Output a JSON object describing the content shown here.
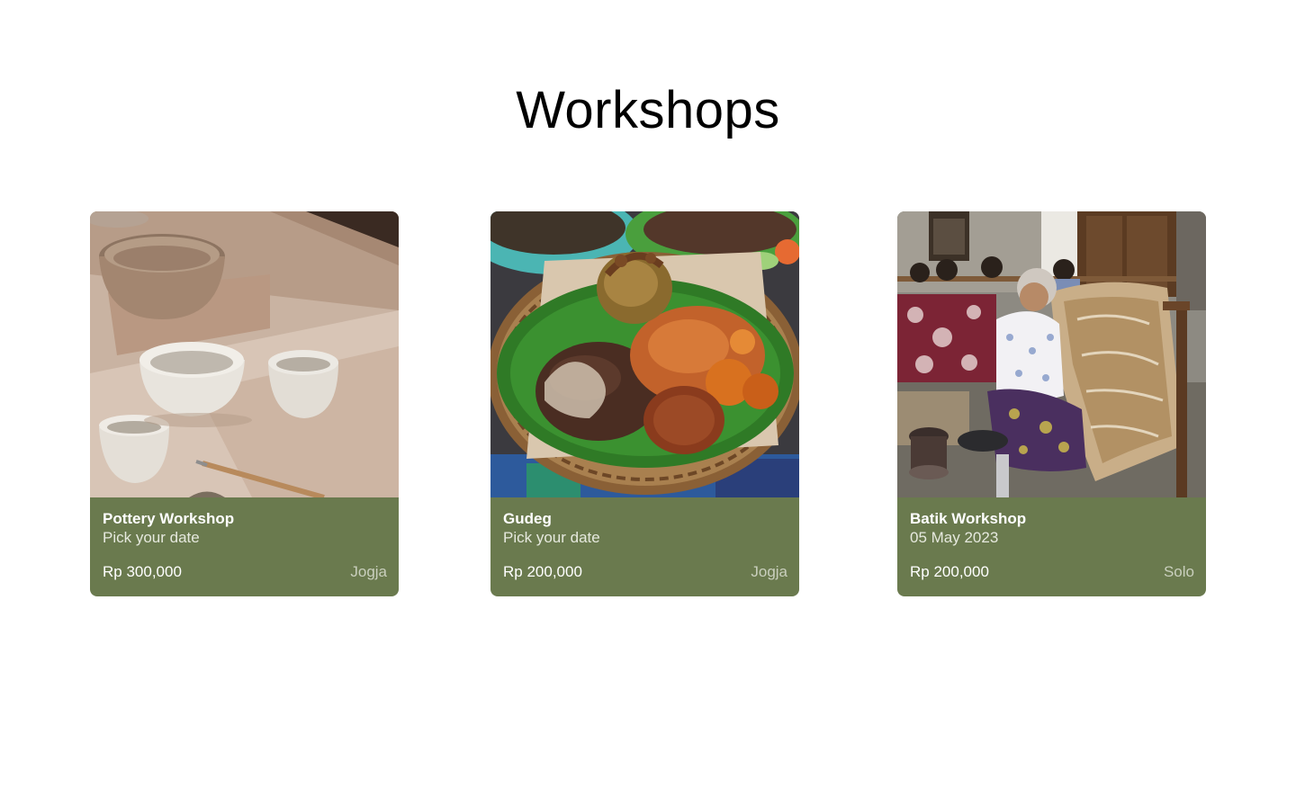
{
  "page": {
    "title": "Workshops"
  },
  "colors": {
    "card_background": "#6a7a4e",
    "card_text": "#ffffff",
    "card_location_text": "#c9cfbd"
  },
  "workshops": [
    {
      "title": "Pottery Workshop",
      "date": "Pick your date",
      "price": "Rp 300,000",
      "location": "Jogja",
      "image_icon": "pottery-photo"
    },
    {
      "title": "Gudeg",
      "date": "Pick your date",
      "price": "Rp 200,000",
      "location": "Jogja",
      "image_icon": "gudeg-food-photo"
    },
    {
      "title": "Batik Workshop",
      "date": "05 May 2023",
      "price": "Rp 200,000",
      "location": "Solo",
      "image_icon": "batik-photo"
    }
  ]
}
